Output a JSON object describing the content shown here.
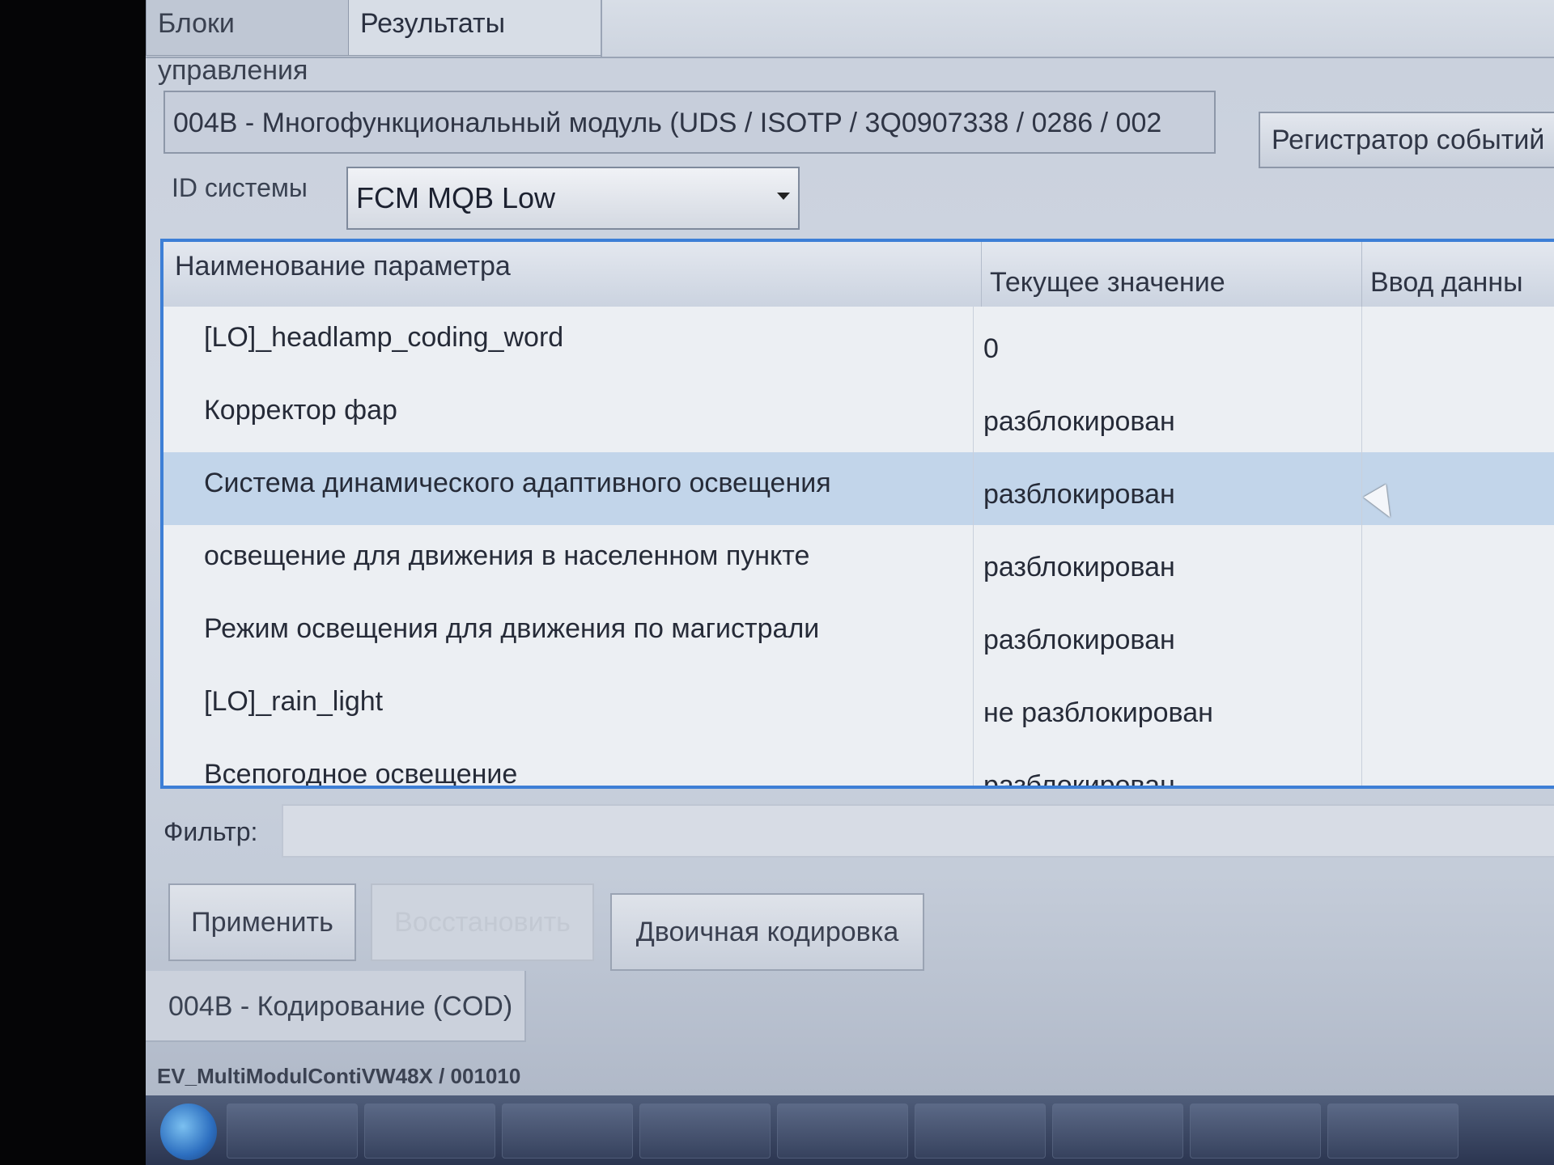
{
  "tabs": [
    {
      "label": "Блоки управления"
    },
    {
      "label": "Результаты"
    }
  ],
  "module": {
    "title": "004B - Многофункциональный модуль  (UDS / ISOTP / 3Q0907338 / 0286 / 002",
    "event_logger_button": "Регистратор событий"
  },
  "system_id": {
    "label": "ID системы",
    "value": "FCM MQB Low"
  },
  "table": {
    "headers": [
      "Наименование параметра",
      "Текущее значение",
      "Ввод данны"
    ],
    "rows": [
      {
        "name": "[LO]_headlamp_coding_word",
        "value": "0"
      },
      {
        "name": "Корректор фар",
        "value": "разблокирован"
      },
      {
        "name": "Система динамического адаптивного освещения",
        "value": "разблокирован"
      },
      {
        "name": "освещение для движения в населенном пункте",
        "value": "разблокирован"
      },
      {
        "name": "Режим освещения для движения по магистрали",
        "value": "разблокирован"
      },
      {
        "name": "[LO]_rain_light",
        "value": "не разблокирован"
      },
      {
        "name": "Всепогодное освещение",
        "value": "разблокирован"
      }
    ],
    "selected_row": 2
  },
  "filter": {
    "label": "Фильтр:",
    "value": ""
  },
  "buttons": {
    "apply": "Применить",
    "restore": "Восстановить",
    "binary": "Двоичная кодировка"
  },
  "coding_tab": "004B - Кодирование (COD)",
  "status": "EV_MultiModulContiVW48X / 001010",
  "colors": {
    "table_border": "#3d7fd6",
    "selected_row": "#c2d5ea"
  },
  "icons": [
    "chevron-down-icon",
    "mouse-cursor-icon",
    "windows-start-icon"
  ]
}
